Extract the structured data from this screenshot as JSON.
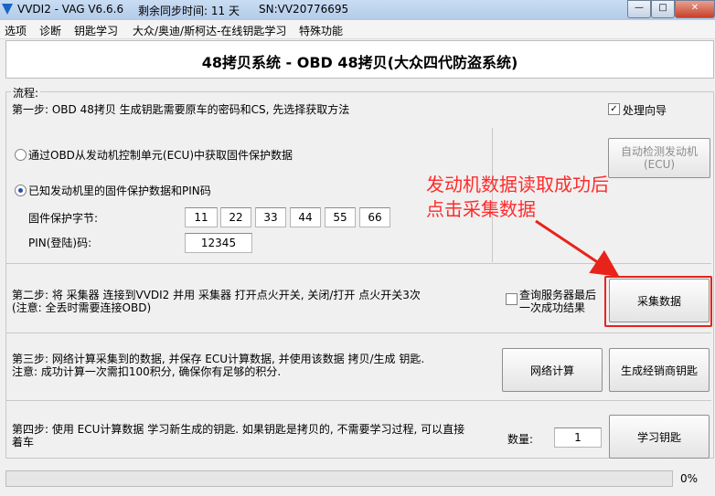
{
  "titlebar": {
    "app_title": "VVDI2 - VAG V6.6.6",
    "sync_label": "剩余同步时间: 11 天",
    "serial": "SN:VV20776695",
    "minimize": "—",
    "maximize": "□"
  },
  "menu": {
    "items": [
      "选项",
      "诊断",
      "钥匙学习",
      "大众/奥迪/斯柯达-在线钥匙学习",
      "特殊功能"
    ]
  },
  "header": {
    "title": "48拷贝系统 - OBD 48拷贝(大众四代防盗系统)"
  },
  "process": {
    "group_label": "流程:",
    "step1_text": "第一步: OBD 48拷贝 生成钥匙需要原车的密码和CS, 先选择获取方法",
    "guide_checkbox": {
      "label": "处理向导",
      "checked": true
    },
    "option_obd": {
      "label": "通过OBD从发动机控制单元(ECU)中获取固件保护数据",
      "selected": false
    },
    "option_known": {
      "label": "已知发动机里的固件保护数据和PIN码",
      "selected": true
    },
    "auto_detect_button": {
      "line1": "自动检测发动机",
      "line2": "(ECU)"
    },
    "firmware_label": "固件保护字节:",
    "firmware_bytes": [
      "11",
      "22",
      "33",
      "44",
      "55",
      "66"
    ],
    "pin_label": "PIN(登陆)码:",
    "pin_value": "12345",
    "step2_line1": "第二步: 将 采集器 连接到VVDI2 并用 采集器 打开点火开关, 关闭/打开 点火开关3次",
    "step2_line2": "(注意: 全丢时需要连接OBD)",
    "query_checkbox": {
      "line1": "查询服务器最后",
      "line2": "一次成功结果",
      "checked": false
    },
    "collect_button": "采集数据",
    "step3_line1": "第三步: 网络计算采集到的数据, 并保存 ECU计算数据, 并使用该数据 拷贝/生成 钥匙.",
    "step3_line2": "注意: 成功计算一次需扣100积分, 确保你有足够的积分.",
    "network_calc_button": "网络计算",
    "dealer_key_button": "生成经销商钥匙",
    "step4_line1": "第四步: 使用 ECU计算数据 学习新生成的钥匙. 如果钥匙是拷贝的, 不需要学习过程, 可以直接",
    "step4_line2": "着车",
    "quantity_label": "数量:",
    "quantity_value": "1",
    "learn_key_button": "学习钥匙"
  },
  "annotation": {
    "line1": "发动机数据读取成功后",
    "line2": "点击采集数据"
  },
  "progress": {
    "percent_label": "0%",
    "fraction": 0.0
  },
  "colors": {
    "annotation": "#ff2b2b",
    "highlight_box": "#e8231b",
    "arrow": "#e8231b"
  }
}
